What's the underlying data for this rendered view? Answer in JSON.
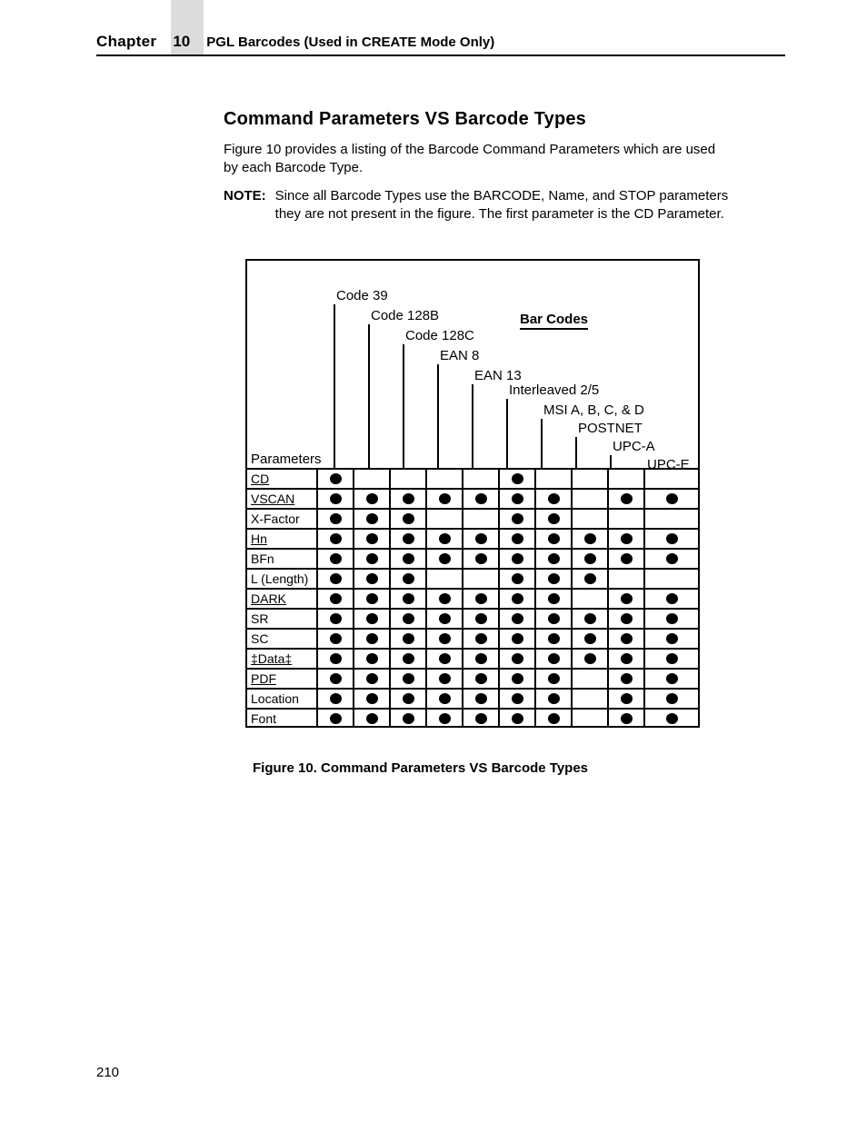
{
  "header": {
    "chapter_label": "Chapter",
    "chapter_number": "10",
    "title": "PGL Barcodes (Used in CREATE Mode Only)"
  },
  "section": {
    "title": "Command Parameters VS Barcode Types",
    "intro": "Figure 10 provides a listing of the Barcode Command Parameters which are used by each Barcode Type.",
    "note_label": "NOTE:",
    "note": "Since all Barcode Types use the BARCODE, Name, and STOP parameters they are not present in the figure. The first parameter is the CD Parameter."
  },
  "figure": {
    "dash": "- -",
    "barcodes_heading": "Bar Codes",
    "columns": [
      "Code 39",
      "Code 128B",
      "Code 128C",
      "EAN 8",
      "EAN 13",
      "Interleaved 2/5",
      "MSI A, B, C, & D",
      "POSTNET",
      "UPC-A",
      "UPC-E"
    ],
    "param_header": "Parameters",
    "rows": [
      {
        "label": "CD",
        "underline": true,
        "dots": [
          1,
          0,
          0,
          0,
          0,
          1,
          0,
          0,
          0,
          0
        ]
      },
      {
        "label": "VSCAN",
        "underline": true,
        "dots": [
          1,
          1,
          1,
          1,
          1,
          1,
          1,
          0,
          1,
          1
        ]
      },
      {
        "label": "X-Factor",
        "underline": false,
        "dots": [
          1,
          1,
          1,
          0,
          0,
          1,
          1,
          0,
          0,
          0
        ]
      },
      {
        "label": "Hn",
        "underline": true,
        "dots": [
          1,
          1,
          1,
          1,
          1,
          1,
          1,
          1,
          1,
          1
        ]
      },
      {
        "label": "BFn",
        "underline": false,
        "dots": [
          1,
          1,
          1,
          1,
          1,
          1,
          1,
          1,
          1,
          1
        ]
      },
      {
        "label": "L (Length)",
        "underline": false,
        "dots": [
          1,
          1,
          1,
          0,
          0,
          1,
          1,
          1,
          0,
          0
        ]
      },
      {
        "label": "DARK",
        "underline": true,
        "dots": [
          1,
          1,
          1,
          1,
          1,
          1,
          1,
          0,
          1,
          1
        ]
      },
      {
        "label": "SR",
        "underline": false,
        "dots": [
          1,
          1,
          1,
          1,
          1,
          1,
          1,
          1,
          1,
          1
        ]
      },
      {
        "label": "SC",
        "underline": false,
        "dots": [
          1,
          1,
          1,
          1,
          1,
          1,
          1,
          1,
          1,
          1
        ]
      },
      {
        "label": "‡Data‡",
        "underline": true,
        "dots": [
          1,
          1,
          1,
          1,
          1,
          1,
          1,
          1,
          1,
          1
        ]
      },
      {
        "label": "PDF",
        "underline": true,
        "dots": [
          1,
          1,
          1,
          1,
          1,
          1,
          1,
          0,
          1,
          1
        ]
      },
      {
        "label": "Location",
        "underline": false,
        "dots": [
          1,
          1,
          1,
          1,
          1,
          1,
          1,
          0,
          1,
          1
        ]
      },
      {
        "label": "Font",
        "underline": false,
        "dots": [
          1,
          1,
          1,
          1,
          1,
          1,
          1,
          0,
          1,
          1
        ]
      }
    ],
    "caption": "Figure 10. Command Parameters VS Barcode Types"
  },
  "page_number": "210"
}
